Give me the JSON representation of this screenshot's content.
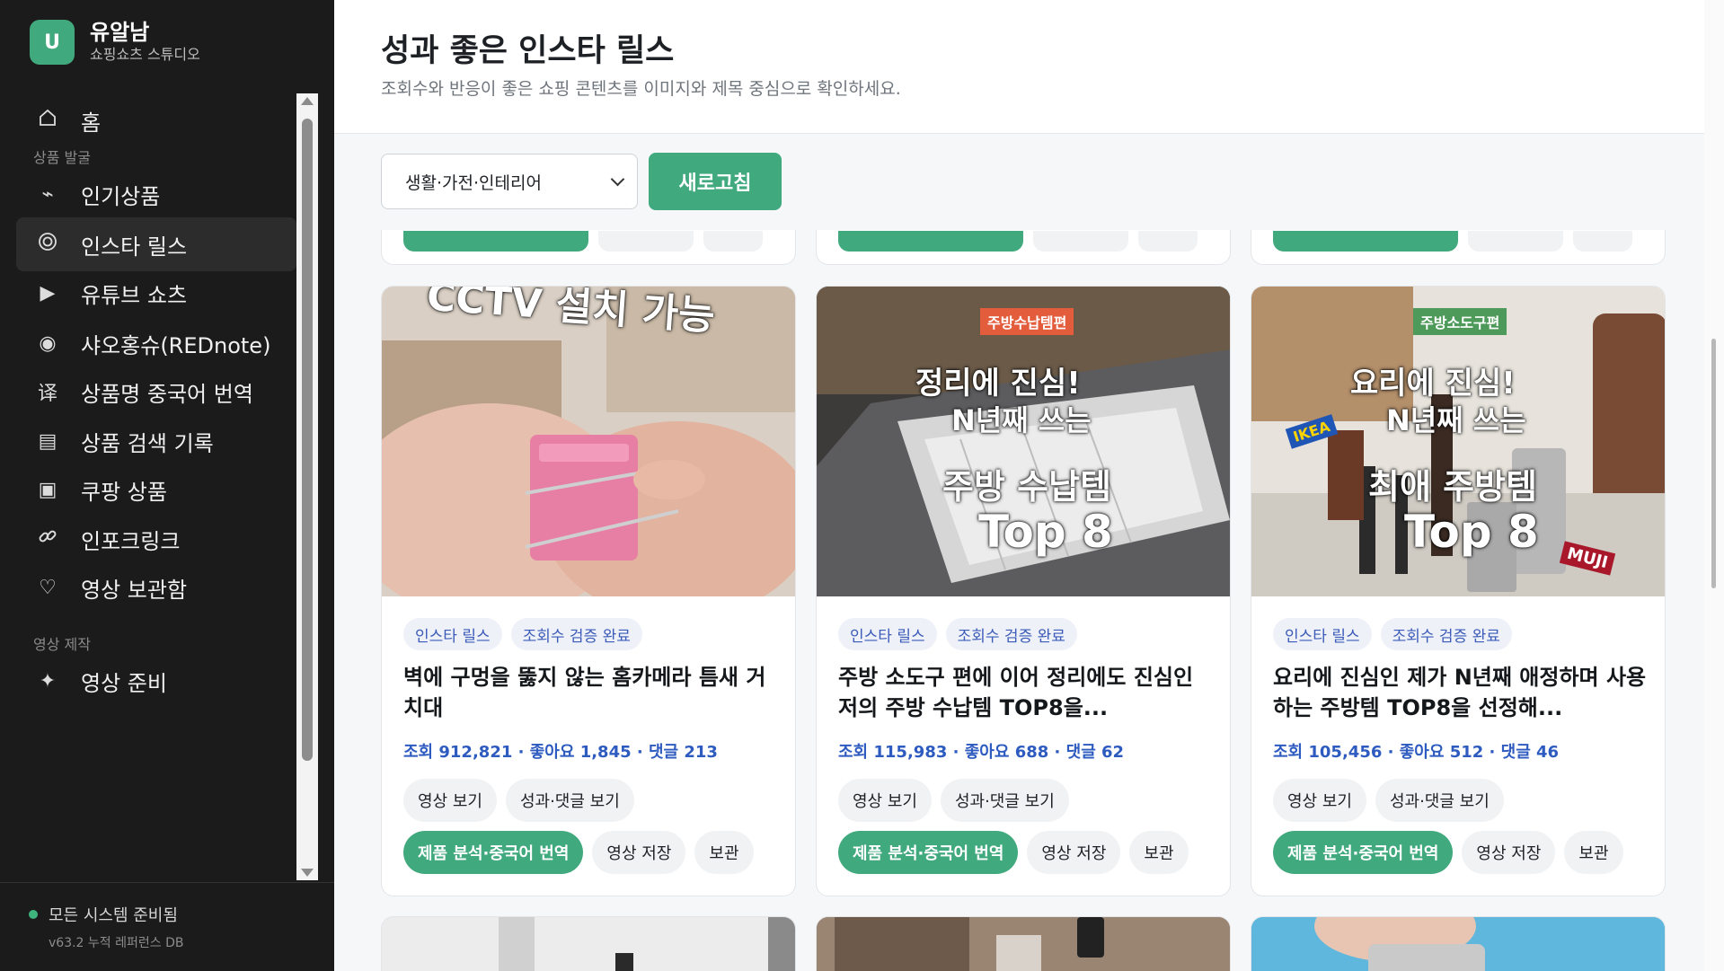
{
  "brand": {
    "logo_letter": "U",
    "name": "유알남",
    "subtitle": "쇼핑쇼츠 스튜디오"
  },
  "sidebar": {
    "home": {
      "label": "홈",
      "icon": "home-icon"
    },
    "section_discovery": "상품 발굴",
    "items": [
      {
        "label": "인기상품",
        "icon": "trend-icon"
      },
      {
        "label": "인스타 릴스",
        "icon": "instagram-icon",
        "active": true
      },
      {
        "label": "유튜브 쇼츠",
        "icon": "play-icon"
      },
      {
        "label": "샤오홍슈(REDnote)",
        "icon": "record-icon"
      },
      {
        "label": "상품명 중국어 번역",
        "icon": "translate-icon"
      },
      {
        "label": "상품 검색 기록",
        "icon": "list-icon"
      },
      {
        "label": "쿠팡 상품",
        "icon": "box-icon"
      },
      {
        "label": "인포크링크",
        "icon": "link-icon"
      },
      {
        "label": "영상 보관함",
        "icon": "heart-icon"
      }
    ],
    "section_production": "영상 제작",
    "production_items": [
      {
        "label": "영상 준비",
        "icon": "sparkle-icon"
      }
    ],
    "status": "모든 시스템 준비됨",
    "version": "v63.2 누적 레퍼런스 DB"
  },
  "header": {
    "title": "성과 좋은 인스타 릴스",
    "subtitle": "조회수와 반응이 좋은 쇼핑 콘텐츠를 이미지와 제목 중심으로 확인하세요."
  },
  "toolbar": {
    "category": "생활·가전·인테리어",
    "refresh_label": "새로고침"
  },
  "card_common": {
    "chip_type": "인스타 릴스",
    "chip_verified": "조회수 검증 완료",
    "watch_label": "영상 보기",
    "perf_label": "성과·댓글 보기",
    "analyze_label": "제품 분석·중국어 번역",
    "save_label": "영상 저장",
    "archive_label": "보관"
  },
  "cards": [
    {
      "thumb_text": "CCTV 설치 가능",
      "title": "벽에 구멍을 뚫지 않는 홈카메라 틈새 거치대",
      "stats": "조회 912,821 · 좋아요 1,845 · 댓글 213"
    },
    {
      "thumb_tag": "주방수납템편",
      "thumb_line1": "정리에 진심!",
      "thumb_line2": "N년째 쓰는",
      "thumb_line3": "주방 수납템",
      "thumb_line4": "Top 8",
      "title": "주방 소도구 편에 이어 정리에도 진심인 저의 주방 수납템 TOP8을...",
      "stats": "조회 115,983 · 좋아요 688 · 댓글 62"
    },
    {
      "thumb_tag": "주방소도구편",
      "thumb_line1": "요리에 진심!",
      "thumb_line2": "N년째 쓰는",
      "thumb_line3": "최애 주방템",
      "thumb_line4": "Top 8",
      "thumb_badge1": "IKEA",
      "thumb_badge2": "MUJI",
      "title": "요리에 진심인 제가 N년째 애정하며 사용하는 주방템 TOP8을 선정해...",
      "stats": "조회 105,456 · 좋아요 512 · 댓글 46"
    }
  ]
}
